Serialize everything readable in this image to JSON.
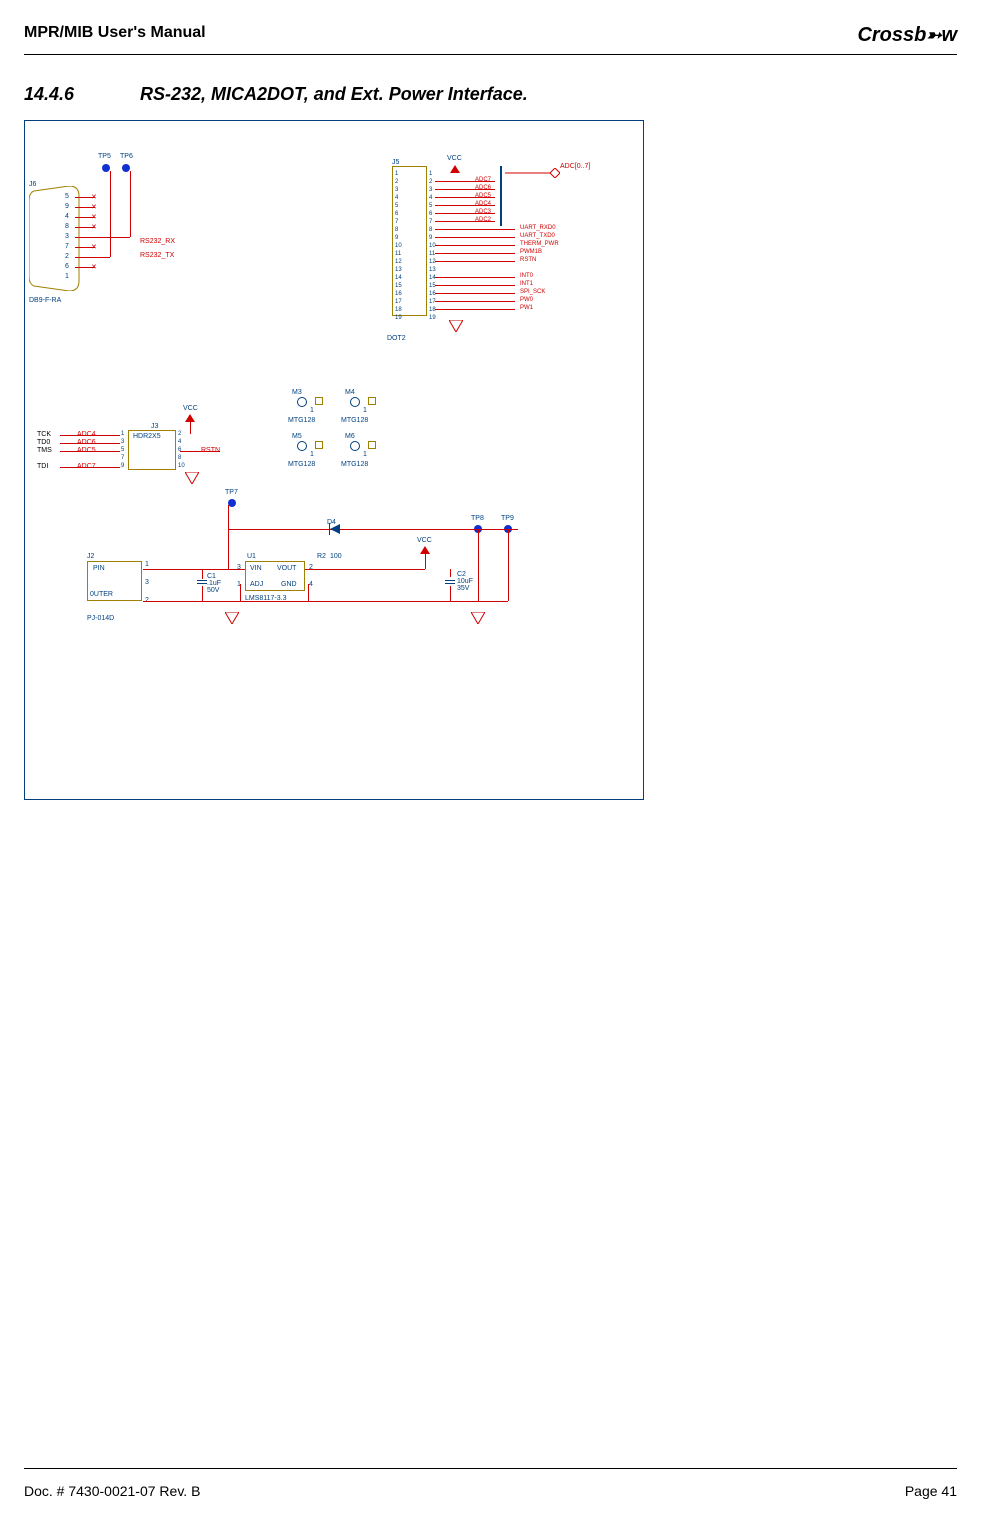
{
  "header": {
    "title": "MPR/MIB User's Manual",
    "logo_text": "Crossb",
    "logo_suffix": "w"
  },
  "section": {
    "number": "14.4.6",
    "title": "RS-232, MICA2DOT, and Ext. Power Interface."
  },
  "test_points": {
    "tp5": "TP5",
    "tp6": "TP6",
    "tp7": "TP7",
    "tp8": "TP8",
    "tp9": "TP9"
  },
  "db9": {
    "ref": "J6",
    "name": "DB9-F-RA",
    "pins": [
      "5",
      "9",
      "4",
      "8",
      "3",
      "7",
      "2",
      "6",
      "1"
    ],
    "sig_rx": "RS232_RX",
    "sig_tx": "RS232_TX"
  },
  "j5": {
    "ref": "J5",
    "name": "DOT2",
    "vcc": "VCC",
    "pins_left": [
      "1",
      "2",
      "3",
      "4",
      "5",
      "6",
      "7",
      "8",
      "9",
      "10",
      "11",
      "12",
      "13",
      "14",
      "15",
      "16",
      "17",
      "18",
      "19"
    ],
    "pins_right": [
      "1",
      "2",
      "3",
      "4",
      "5",
      "6",
      "7",
      "8",
      "9",
      "10",
      "11",
      "12",
      "13",
      "14",
      "15",
      "16",
      "17",
      "18",
      "19"
    ],
    "signals_top": [
      "ADC7",
      "ADC6",
      "ADC5",
      "ADC4",
      "ADC3",
      "ADC2"
    ],
    "signals_bot": [
      "UART_RXD0",
      "UART_TXD0",
      "THERM_PWR",
      "PWM1B",
      "RSTN",
      "",
      "INT0",
      "INT1",
      "SPI_SCK",
      "PW0",
      "PW1"
    ],
    "bus_label": "ADC[0..7]"
  },
  "j3": {
    "ref": "J3",
    "name": "HDR2X5",
    "vcc": "VCC",
    "pins_left": [
      "1",
      "3",
      "5",
      "7",
      "9"
    ],
    "pins_right": [
      "2",
      "4",
      "6",
      "8",
      "10"
    ],
    "left_labels": [
      "TCK",
      "TD0",
      "TMS",
      "",
      "TDI"
    ],
    "left_sigs": [
      "ADC4",
      "ADC6",
      "ADC5",
      "",
      "ADC7"
    ],
    "right_sig": "RSTN"
  },
  "mtg": {
    "m3": "M3",
    "m4": "M4",
    "m5": "M5",
    "m6": "M6",
    "pin": "1",
    "name": "MTG128"
  },
  "power": {
    "j2_ref": "J2",
    "j2_pin": "PIN",
    "j2_outer": "0UTER",
    "j2_name": "PJ-014D",
    "j2_pins": [
      "1",
      "3",
      "2"
    ],
    "c1_ref": "C1",
    "c1_val": ".1uF",
    "c1_volt": "50V",
    "u1_ref": "U1",
    "u1_name": "LMS8117-3.3",
    "u1_vin": "VIN",
    "u1_vout": "VOUT",
    "u1_adj": "ADJ",
    "u1_gnd": "GND",
    "u1_pins": [
      "3",
      "1",
      "2",
      "4"
    ],
    "r2_ref": "R2",
    "r2_val": "100",
    "c2_ref": "C2",
    "c2_val": "10uF",
    "c2_volt": "35V",
    "d4_ref": "D4",
    "vcc": "VCC"
  },
  "footer": {
    "doc": "Doc. # 7430-0021-07 Rev. B",
    "page": "Page 41"
  }
}
